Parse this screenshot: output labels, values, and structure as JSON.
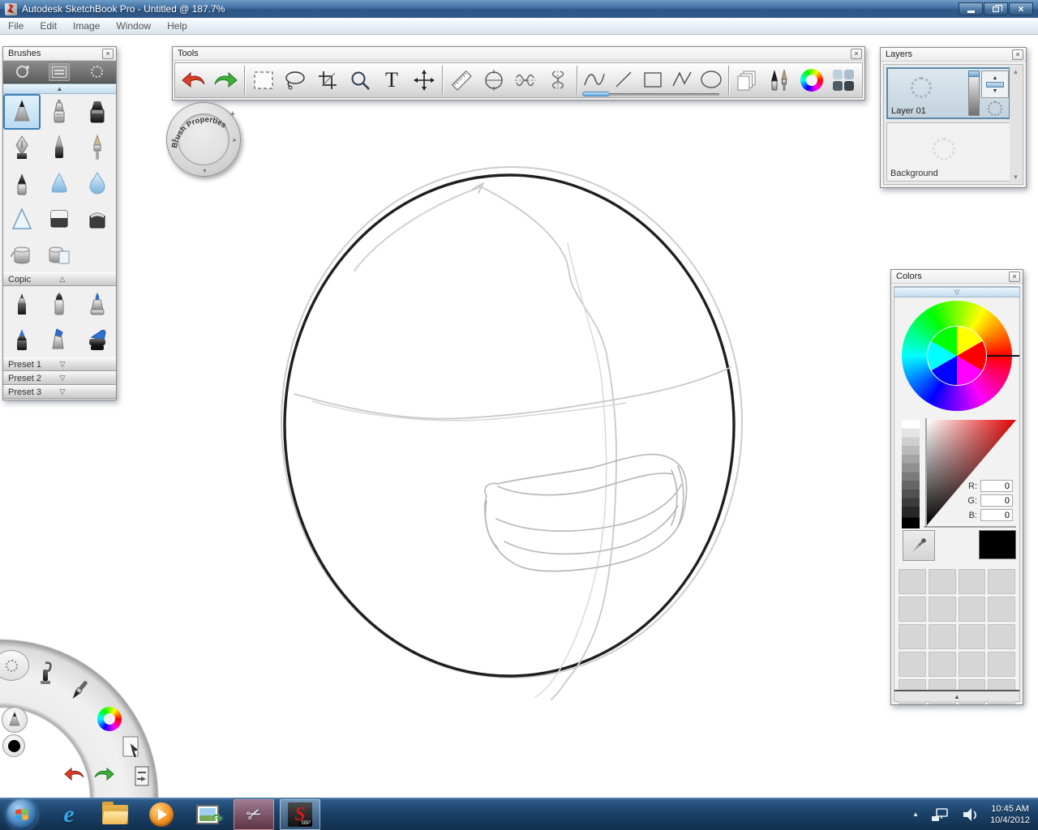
{
  "window": {
    "title": "Autodesk SketchBook Pro - Untitled @ 187.7%",
    "controls": [
      "minimize",
      "restore",
      "close"
    ]
  },
  "menu": {
    "items": [
      "File",
      "Edit",
      "Image",
      "Window",
      "Help"
    ]
  },
  "brushes_panel": {
    "title": "Brushes",
    "header_icons": [
      "stroke-preview",
      "brush-properties",
      "brush-texture"
    ],
    "brush_names": [
      "pencil",
      "airbrush",
      "broad-marker",
      "chisel-pen",
      "ballpoint-pen",
      "paintbrush",
      "felt-marker",
      "smear",
      "watercolor-drop",
      "triangle-brush",
      "eraser-hard",
      "eraser-soft",
      "flood-fill",
      "flood-fill-layer"
    ],
    "selected_brush": "pencil",
    "copic_label": "Copic",
    "copic_names": [
      "copic-fine",
      "copic-bullet",
      "copic-brush-blue",
      "copic-dark",
      "copic-chisel",
      "copic-wide"
    ],
    "presets": [
      "Preset 1",
      "Preset 2",
      "Preset 3"
    ]
  },
  "tools_panel": {
    "title": "Tools",
    "tools": [
      "undo",
      "redo",
      "rectangle-select",
      "lasso-select",
      "crop",
      "zoom",
      "text",
      "move",
      "ruler",
      "ellipse-guide",
      "symmetry-horizontal",
      "symmetry-vertical",
      "draw-freehand",
      "draw-line",
      "draw-rectangle",
      "draw-polyline",
      "draw-ellipse",
      "layer-pages",
      "brush-editor",
      "color-editor",
      "swatches"
    ]
  },
  "brush_puck": {
    "label": "Brush Properties",
    "plus": "+"
  },
  "layers_panel": {
    "title": "Layers",
    "layers": [
      {
        "name": "Layer 01",
        "selected": true
      },
      {
        "name": "Background",
        "selected": false
      }
    ]
  },
  "colors_panel": {
    "title": "Colors",
    "r_label": "R:",
    "g_label": "G:",
    "b_label": "B:",
    "r_value": "0",
    "g_value": "0",
    "b_value": "0",
    "current_color": "#000000",
    "swatch_rows": 5,
    "swatch_cols": 4
  },
  "taskbar": {
    "buttons": [
      "start",
      "internet-explorer",
      "windows-explorer",
      "media-player",
      "image-capture",
      "snipping-tool",
      "sketchbook-pro"
    ],
    "active_button": "sketchbook-pro",
    "clock_time": "10:45 AM",
    "clock_date": "10/4/2012"
  },
  "colors": {
    "selection_blue": "#3d7fb5",
    "undo_red": "#d8402a",
    "redo_green": "#3fae3f",
    "titlebar_blue": "#3f6ea3",
    "current_swatch": "#000000"
  }
}
